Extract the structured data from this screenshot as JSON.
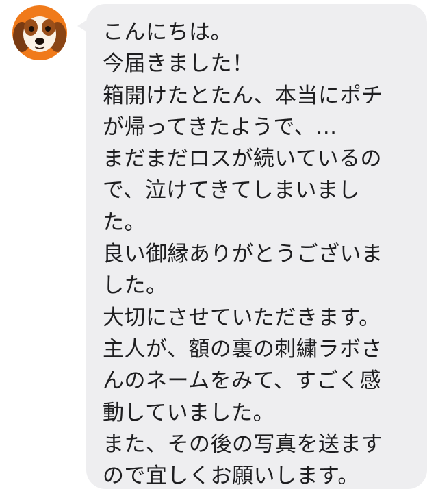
{
  "colors": {
    "bubble": "#eeeef0",
    "text": "#1e1e20",
    "avatar_bg": "#f07a1a"
  },
  "avatar": {
    "icon": "dog-avatar-icon"
  },
  "message": {
    "lines": [
      "こんにちは。",
      "今届きました！",
      "箱開けたとたん、本当にポチ",
      "が帰ってきたようで、…",
      "まだまだロスが続いているの",
      "で、泣けてきてしまいまし",
      "た。",
      "良い御縁ありがとうございま",
      "した。",
      "大切にさせていただきます。",
      "主人が、額の裏の刺繍ラボさ",
      "んのネームをみて、すごく感",
      "動していました。",
      "また、その後の写真を送ます",
      "ので宜しくお願いします。"
    ]
  }
}
